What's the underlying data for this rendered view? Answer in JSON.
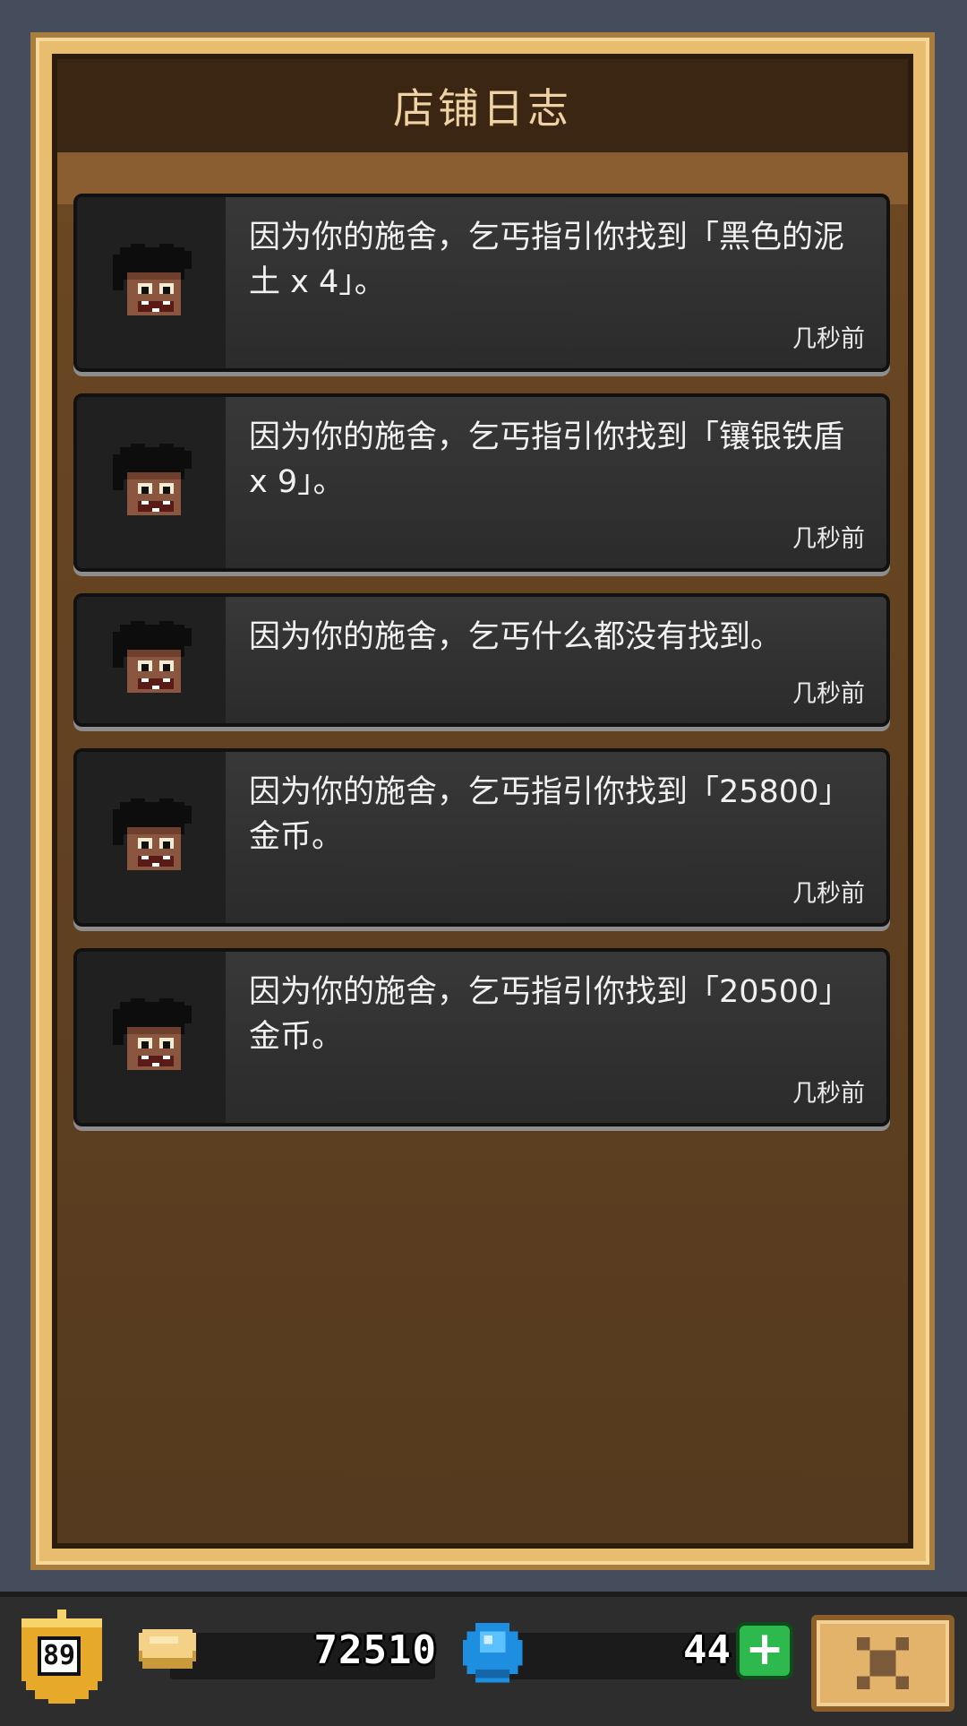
{
  "dialog": {
    "title": "店铺日志"
  },
  "log_entries": [
    {
      "message": "因为你的施舍，乞丐指引你找到「黑色的泥土 x 4」。",
      "time": "几秒前"
    },
    {
      "message": "因为你的施舍，乞丐指引你找到「镶银铁盾 x 9」。",
      "time": "几秒前"
    },
    {
      "message": "因为你的施舍，乞丐什么都没有找到。",
      "time": "几秒前"
    },
    {
      "message": "因为你的施舍，乞丐指引你找到「25800」金币。",
      "time": "几秒前"
    },
    {
      "message": "因为你的施舍，乞丐指引你找到「20500」金币。",
      "time": "几秒前"
    }
  ],
  "bottom_bar": {
    "level": "89",
    "coins": "72510",
    "gems": "44",
    "plus_label": "+"
  },
  "colors": {
    "frame": "#e8bd6f",
    "panel": "#6f4c26",
    "card": "#2f2f2f",
    "gem": "#1e8fe0",
    "plus": "#2db94d"
  },
  "icons": [
    "beggar-portrait-icon",
    "level-shield-icon",
    "gold-coin-icon",
    "blue-gem-icon",
    "plus-icon",
    "close-x-icon"
  ]
}
